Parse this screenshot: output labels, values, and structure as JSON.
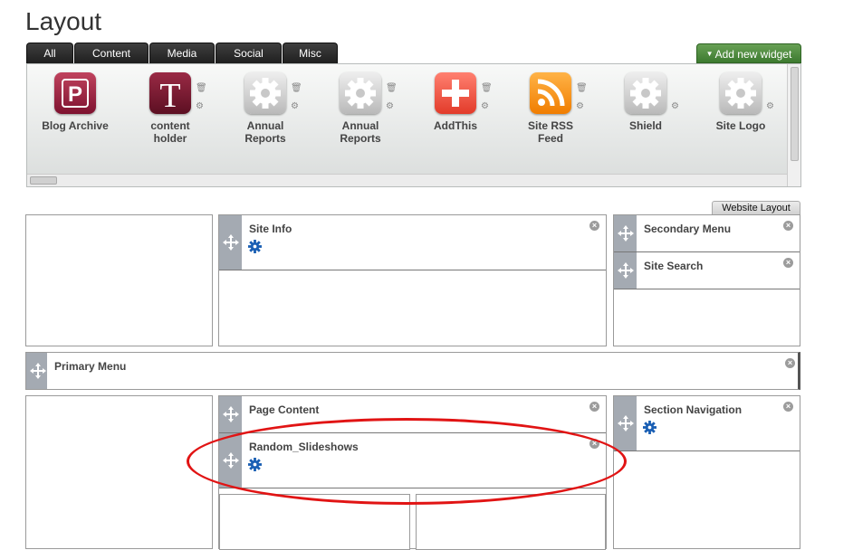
{
  "page": {
    "title": "Layout"
  },
  "tabs": [
    {
      "label": "All"
    },
    {
      "label": "Content"
    },
    {
      "label": "Media"
    },
    {
      "label": "Social"
    },
    {
      "label": "Misc"
    }
  ],
  "toolbar": {
    "add_widget_label": "Add new widget"
  },
  "library": {
    "widgets": [
      {
        "label": "Blog Archive",
        "icon": "blog-archive-p-icon",
        "glyph": "P"
      },
      {
        "label": "content\nholder",
        "icon": "content-holder-t-icon",
        "glyph": "T"
      },
      {
        "label": "Annual\nReports",
        "icon": "gear-icon"
      },
      {
        "label": "Annual\nReports",
        "icon": "gear-icon"
      },
      {
        "label": "AddThis",
        "icon": "plus-icon"
      },
      {
        "label": "Site RSS\nFeed",
        "icon": "rss-icon"
      },
      {
        "label": "Shield",
        "icon": "gear-icon"
      },
      {
        "label": "Site Logo",
        "icon": "gear-icon"
      }
    ]
  },
  "layout": {
    "tab_label": "Website Layout",
    "widgets": {
      "site_info": "Site Info",
      "secondary_menu": "Secondary Menu",
      "site_search": "Site Search",
      "primary_menu": "Primary Menu",
      "page_content": "Page Content",
      "random_slideshows": "Random_Slideshows",
      "section_navigation": "Section Navigation"
    }
  },
  "icons": {
    "close": "×",
    "move": "move-arrows-icon",
    "config": "config-gear-icon"
  },
  "colors": {
    "highlight": "#e11414",
    "add_button": "#4d8a3d",
    "tab_bg": "#2e2e2e",
    "handle": "#a4aab2",
    "config_blue": "#1a5fb4"
  }
}
